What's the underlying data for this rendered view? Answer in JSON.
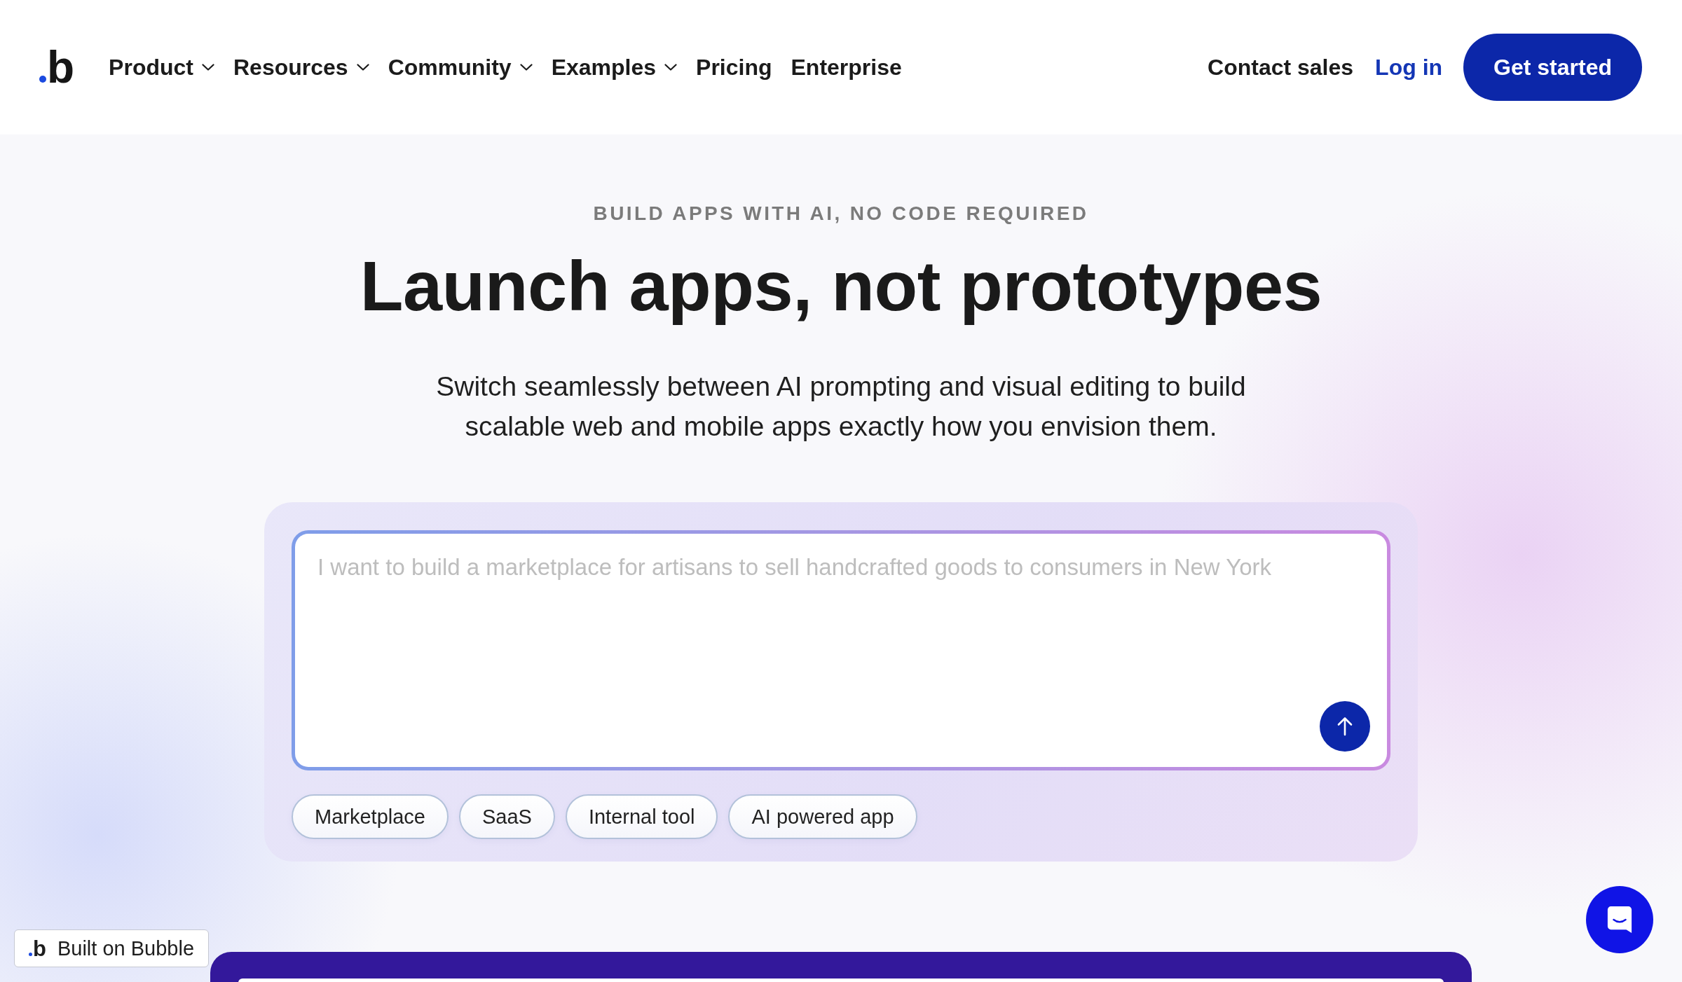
{
  "header": {
    "logo": "b",
    "nav": [
      {
        "label": "Product",
        "dropdown": true
      },
      {
        "label": "Resources",
        "dropdown": true
      },
      {
        "label": "Community",
        "dropdown": true
      },
      {
        "label": "Examples",
        "dropdown": true
      },
      {
        "label": "Pricing",
        "dropdown": false
      },
      {
        "label": "Enterprise",
        "dropdown": false
      }
    ],
    "contact_sales": "Contact sales",
    "log_in": "Log in",
    "get_started": "Get started"
  },
  "hero": {
    "eyebrow": "BUILD APPS WITH AI, NO CODE REQUIRED",
    "title": "Launch apps, not prototypes",
    "subtitle": "Switch seamlessly between AI prompting and visual editing to build scalable web and mobile apps exactly how you envision them."
  },
  "prompt": {
    "placeholder": "I want to build a marketplace for artisans to sell handcrafted goods to consumers in New York",
    "suggestions": [
      "Marketplace",
      "SaaS",
      "Internal tool",
      "AI powered app"
    ]
  },
  "built_on_badge": {
    "logo": "b",
    "label": "Built on Bubble"
  }
}
